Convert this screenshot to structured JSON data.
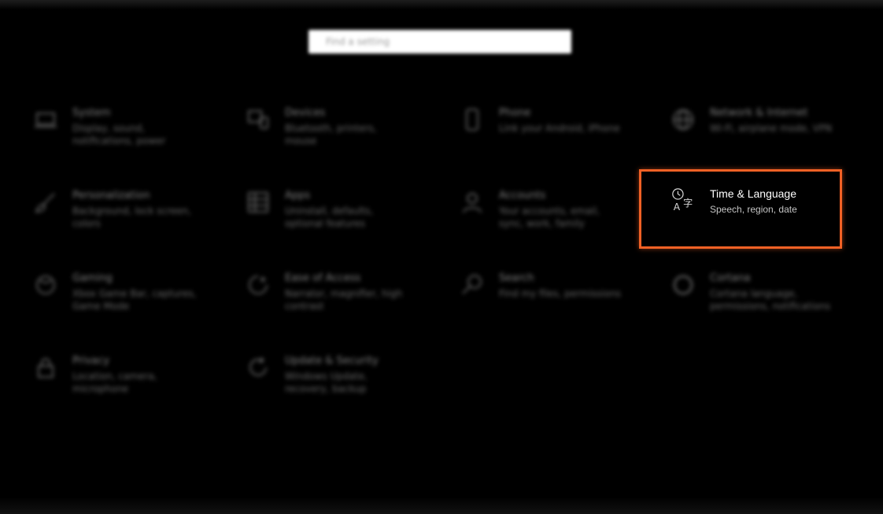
{
  "search": {
    "placeholder": "Find a setting"
  },
  "tiles": [
    {
      "title": "System",
      "subtitle": "Display, sound, notifications, power",
      "icon": "laptop-icon"
    },
    {
      "title": "Devices",
      "subtitle": "Bluetooth, printers, mouse",
      "icon": "devices-icon"
    },
    {
      "title": "Phone",
      "subtitle": "Link your Android, iPhone",
      "icon": "phone-icon"
    },
    {
      "title": "Network & Internet",
      "subtitle": "Wi-Fi, airplane mode, VPN",
      "icon": "globe-icon"
    },
    {
      "title": "Personalization",
      "subtitle": "Background, lock screen, colors",
      "icon": "paintbrush-icon"
    },
    {
      "title": "Apps",
      "subtitle": "Uninstall, defaults, optional features",
      "icon": "apps-icon"
    },
    {
      "title": "Accounts",
      "subtitle": "Your accounts, email, sync, work, family",
      "icon": "person-icon"
    },
    {
      "title": "Time & Language",
      "subtitle": "Speech, region, date",
      "icon": "time-language-icon"
    },
    {
      "title": "Gaming",
      "subtitle": "Xbox Game Bar, captures, Game Mode",
      "icon": "gaming-icon"
    },
    {
      "title": "Ease of Access",
      "subtitle": "Narrator, magnifier, high contrast",
      "icon": "ease-of-access-icon"
    },
    {
      "title": "Search",
      "subtitle": "Find my files, permissions",
      "icon": "search-icon"
    },
    {
      "title": "Cortana",
      "subtitle": "Cortana language, permissions, notifications",
      "icon": "cortana-icon"
    },
    {
      "title": "Privacy",
      "subtitle": "Location, camera, microphone",
      "icon": "lock-icon"
    },
    {
      "title": "Update & Security",
      "subtitle": "Windows Update, recovery, backup",
      "icon": "update-icon"
    }
  ],
  "colors": {
    "highlight": "#f26125",
    "background": "#000000"
  }
}
